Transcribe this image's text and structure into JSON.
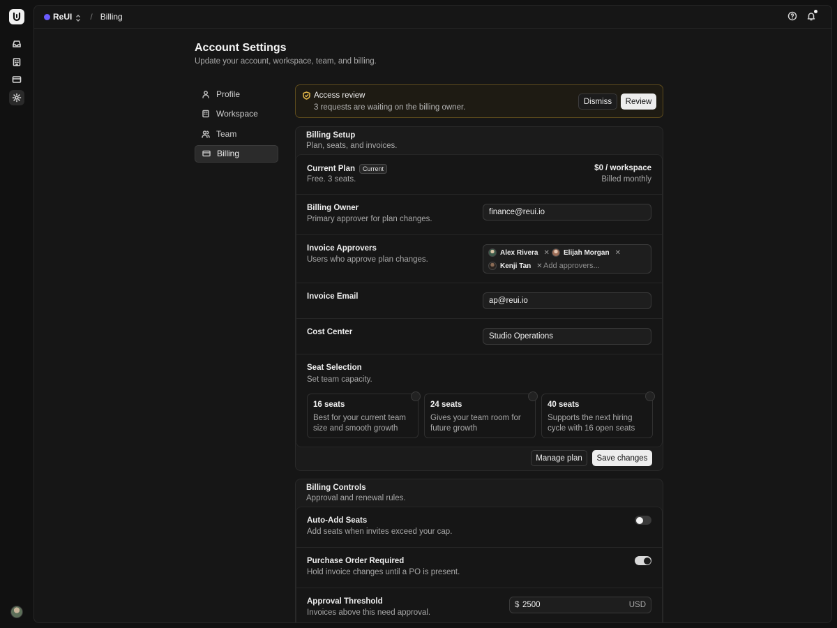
{
  "topbar": {
    "workspace": "ReUI",
    "separator": "/",
    "breadcrumb": "Billing"
  },
  "page": {
    "title": "Account Settings",
    "subtitle": "Update your account, workspace, team, and billing."
  },
  "nav": {
    "items": [
      {
        "label": "Profile",
        "icon": "user-icon"
      },
      {
        "label": "Workspace",
        "icon": "building-icon"
      },
      {
        "label": "Team",
        "icon": "users-icon"
      },
      {
        "label": "Billing",
        "icon": "credit-card-icon",
        "active": true
      }
    ]
  },
  "alert": {
    "title": "Access review",
    "description": "3 requests are waiting on the billing owner.",
    "dismiss": "Dismiss",
    "review": "Review"
  },
  "billing_setup": {
    "title": "Billing Setup",
    "description": "Plan, seats, and invoices.",
    "current_plan": {
      "title": "Current Plan",
      "badge": "Current",
      "description": "Free. 3 seats.",
      "price": "$0 / workspace",
      "period": "Billed monthly"
    },
    "billing_owner": {
      "title": "Billing Owner",
      "description": "Primary approver for plan changes.",
      "value": "finance@reui.io"
    },
    "invoice_approvers": {
      "title": "Invoice Approvers",
      "description": "Users who approve plan changes.",
      "tags": [
        "Alex Rivera",
        "Elijah Morgan",
        "Kenji Tan"
      ],
      "placeholder": "Add approvers..."
    },
    "invoice_email": {
      "title": "Invoice Email",
      "value": "ap@reui.io"
    },
    "cost_center": {
      "title": "Cost Center",
      "value": "Studio Operations"
    },
    "seat_selection": {
      "title": "Seat Selection",
      "description": "Set team capacity.",
      "options": [
        {
          "title": "16 seats",
          "description": "Best for your current team size and smooth growth"
        },
        {
          "title": "24 seats",
          "description": "Gives your team room for future growth"
        },
        {
          "title": "40 seats",
          "description": "Supports the next hiring cycle with 16 open seats"
        }
      ]
    },
    "manage_plan": "Manage plan",
    "save_changes": "Save changes"
  },
  "billing_controls": {
    "title": "Billing Controls",
    "description": "Approval and renewal rules.",
    "auto_add": {
      "title": "Auto-Add Seats",
      "description": "Add seats when invites exceed your cap.",
      "enabled": false
    },
    "po_required": {
      "title": "Purchase Order Required",
      "description": "Hold invoice changes until a PO is present.",
      "enabled": true
    },
    "threshold": {
      "title": "Approval Threshold",
      "description": "Invoices above this need approval.",
      "currency_symbol": "$",
      "value": "2500",
      "unit": "USD"
    }
  },
  "colors": {
    "accent_dot": "#6b5cff",
    "alert_border": "#5c4a1c",
    "alert_icon": "#e6b94a"
  }
}
